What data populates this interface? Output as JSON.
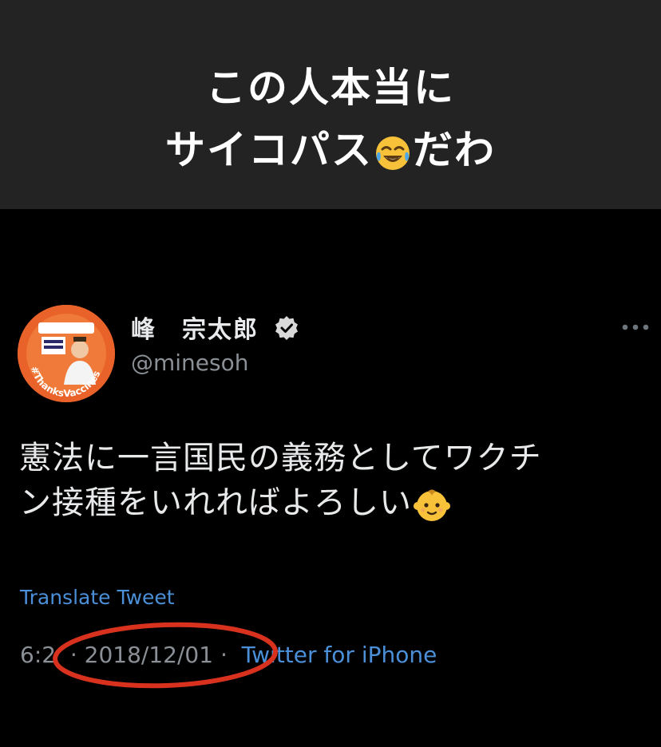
{
  "caption": {
    "line1": "この人本当に",
    "line2_prefix": "サイコパス",
    "line2_emoji": "face-with-tears-of-joy-emoji",
    "line2_suffix": "だわ",
    "band_color": "#232323"
  },
  "tweet": {
    "author": {
      "name": "峰　宗太郎",
      "handle": "@minesoh",
      "verified": true,
      "avatar_text": "#ThanksVaccines"
    },
    "more_icon": "more-dots-icon",
    "text_line1": "憲法に一言国民の義務としてワクチ",
    "text_line2": "ン接種をいれればよろしい",
    "text_emoji": "baby-emoji",
    "translate_label": "Translate Tweet",
    "meta": {
      "time": "6:2",
      "date": "· 2018/12/01 ·",
      "source": "Twitter for iPhone"
    },
    "annotation_color": "#d8321f",
    "link_color": "#4a8fd8"
  }
}
